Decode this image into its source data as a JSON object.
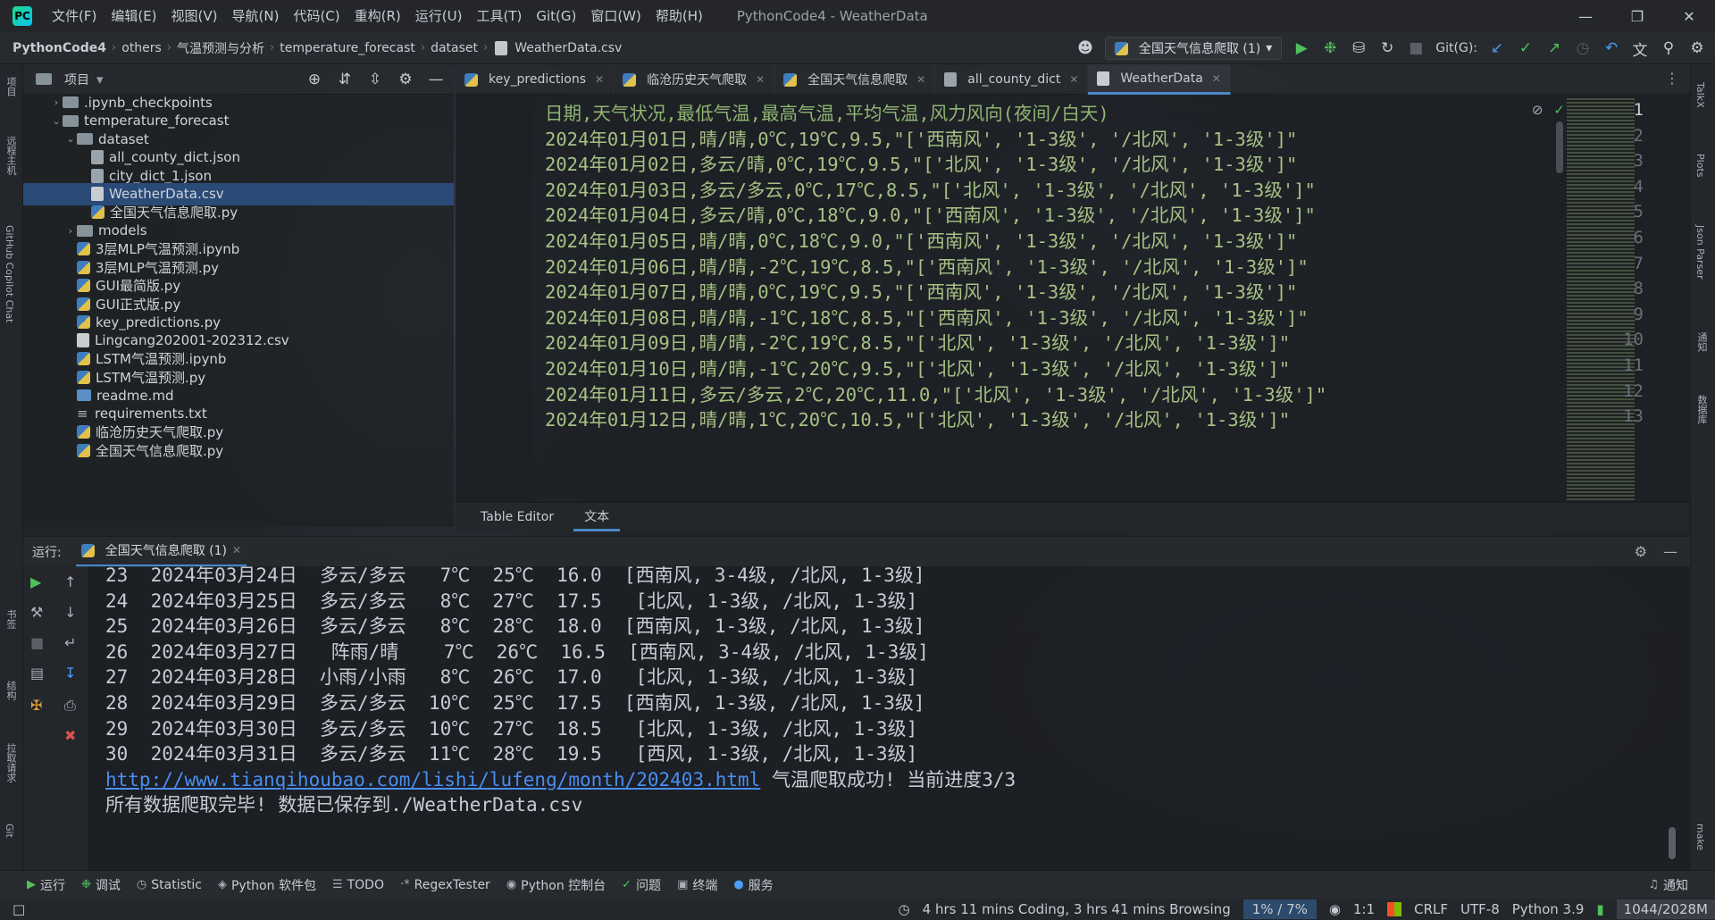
{
  "menubar": {
    "items": [
      "文件(F)",
      "编辑(E)",
      "视图(V)",
      "导航(N)",
      "代码(C)",
      "重构(R)",
      "运行(U)",
      "工具(T)",
      "Git(G)",
      "窗口(W)",
      "帮助(H)"
    ],
    "window_title": "PythonCode4 - WeatherData"
  },
  "breadcrumb": [
    "PythonCode4",
    "others",
    "气温预测与分析",
    "temperature_forecast",
    "dataset",
    "WeatherData.csv"
  ],
  "toolbar": {
    "run_config": "全国天气信息爬取 (1)",
    "git_label": "Git(G):"
  },
  "left_stripe": {
    "items": [
      "项目",
      "远程主机",
      "GitHub Copilot Chat",
      "书签",
      "结构",
      "拉取请求",
      "Git"
    ]
  },
  "right_stripe": {
    "items": [
      "TalkX",
      "Plots",
      "Json Parser",
      "通知",
      "数据库",
      "make"
    ]
  },
  "project": {
    "title": "项目",
    "tree": [
      {
        "label": ".ipynb_checkpoints",
        "type": "folder",
        "depth": 1,
        "arrow": "›"
      },
      {
        "label": "temperature_forecast",
        "type": "folder",
        "depth": 1,
        "arrow": "⌄"
      },
      {
        "label": "dataset",
        "type": "folder",
        "depth": 2,
        "arrow": "⌄"
      },
      {
        "label": "all_county_dict.json",
        "type": "json",
        "depth": 3,
        "arrow": ""
      },
      {
        "label": "city_dict_1.json",
        "type": "json",
        "depth": 3,
        "arrow": ""
      },
      {
        "label": "WeatherData.csv",
        "type": "csv",
        "depth": 3,
        "arrow": "",
        "selected": true
      },
      {
        "label": "全国天气信息爬取.py",
        "type": "py",
        "depth": 3,
        "arrow": ""
      },
      {
        "label": "models",
        "type": "folder",
        "depth": 2,
        "arrow": "›"
      },
      {
        "label": "3层MLP气温预测.ipynb",
        "type": "py",
        "depth": 2,
        "arrow": ""
      },
      {
        "label": "3层MLP气温预测.py",
        "type": "py",
        "depth": 2,
        "arrow": ""
      },
      {
        "label": "GUI最简版.py",
        "type": "py",
        "depth": 2,
        "arrow": ""
      },
      {
        "label": "GUI正式版.py",
        "type": "py",
        "depth": 2,
        "arrow": ""
      },
      {
        "label": "key_predictions.py",
        "type": "py",
        "depth": 2,
        "arrow": ""
      },
      {
        "label": "Lingcang202001-202312.csv",
        "type": "csv",
        "depth": 2,
        "arrow": ""
      },
      {
        "label": "LSTM气温预测.ipynb",
        "type": "py",
        "depth": 2,
        "arrow": ""
      },
      {
        "label": "LSTM气温预测.py",
        "type": "py",
        "depth": 2,
        "arrow": ""
      },
      {
        "label": "readme.md",
        "type": "md",
        "depth": 2,
        "arrow": ""
      },
      {
        "label": "requirements.txt",
        "type": "txt",
        "depth": 2,
        "arrow": ""
      },
      {
        "label": "临沧历史天气爬取.py",
        "type": "py",
        "depth": 2,
        "arrow": ""
      },
      {
        "label": "全国天气信息爬取.py",
        "type": "py",
        "depth": 2,
        "arrow": ""
      }
    ]
  },
  "editor": {
    "tabs": [
      {
        "label": "key_predictions",
        "active": false
      },
      {
        "label": "临沧历史天气爬取",
        "active": false
      },
      {
        "label": "全国天气信息爬取",
        "active": false
      },
      {
        "label": "all_county_dict",
        "active": false
      },
      {
        "label": "WeatherData",
        "active": true
      }
    ],
    "lines": [
      "日期,天气状况,最低气温,最高气温,平均气温,风力风向(夜间/白天)",
      "2024年01月01日,晴/晴,0℃,19℃,9.5,\"['西南风', '1-3级', '/北风', '1-3级']\"",
      "2024年01月02日,多云/晴,0℃,19℃,9.5,\"['北风', '1-3级', '/北风', '1-3级']\"",
      "2024年01月03日,多云/多云,0℃,17℃,8.5,\"['北风', '1-3级', '/北风', '1-3级']\"",
      "2024年01月04日,多云/晴,0℃,18℃,9.0,\"['西南风', '1-3级', '/北风', '1-3级']\"",
      "2024年01月05日,晴/晴,0℃,18℃,9.0,\"['西南风', '1-3级', '/北风', '1-3级']\"",
      "2024年01月06日,晴/晴,-2℃,19℃,8.5,\"['西南风', '1-3级', '/北风', '1-3级']\"",
      "2024年01月07日,晴/晴,0℃,19℃,9.5,\"['西南风', '1-3级', '/北风', '1-3级']\"",
      "2024年01月08日,晴/晴,-1℃,18℃,8.5,\"['西南风', '1-3级', '/北风', '1-3级']\"",
      "2024年01月09日,晴/晴,-2℃,19℃,8.5,\"['北风', '1-3级', '/北风', '1-3级']\"",
      "2024年01月10日,晴/晴,-1℃,20℃,9.5,\"['北风', '1-3级', '/北风', '1-3级']\"",
      "2024年01月11日,多云/多云,2℃,20℃,11.0,\"['北风', '1-3级', '/北风', '1-3级']\"",
      "2024年01月12日,晴/晴,1℃,20℃,10.5,\"['北风', '1-3级', '/北风', '1-3级']\""
    ],
    "bottom_tabs": [
      {
        "label": "Table Editor",
        "active": false
      },
      {
        "label": "文本",
        "active": true
      }
    ]
  },
  "run_panel": {
    "label": "运行:",
    "tab": "全国天气信息爬取 (1)",
    "rows": [
      "23  2024年03月24日  多云/多云   7℃  25℃  16.0  [西南风, 3-4级, /北风, 1-3级]",
      "24  2024年03月25日  多云/多云   8℃  27℃  17.5   [北风, 1-3级, /北风, 1-3级]",
      "25  2024年03月26日  多云/多云   8℃  28℃  18.0  [西南风, 1-3级, /北风, 1-3级]",
      "26  2024年03月27日   阵雨/晴    7℃  26℃  16.5  [西南风, 3-4级, /北风, 1-3级]",
      "27  2024年03月28日  小雨/小雨   8℃  26℃  17.0   [北风, 1-3级, /北风, 1-3级]",
      "28  2024年03月29日  多云/多云  10℃  25℃  17.5  [西南风, 1-3级, /北风, 1-3级]",
      "29  2024年03月30日  多云/多云  10℃  27℃  18.5   [北风, 1-3级, /北风, 1-3级]",
      "30  2024年03月31日  多云/多云  11℃  28℃  19.5   [西风, 1-3级, /北风, 1-3级]"
    ],
    "link": "http://www.tianqihoubao.com/lishi/lufeng/month/202403.html",
    "link_suffix": " 气温爬取成功! 当前进度3/3",
    "final": "所有数据爬取完毕! 数据已保存到./WeatherData.csv"
  },
  "tool_windows": [
    {
      "label": "运行",
      "icon": "play-icon"
    },
    {
      "label": "调试",
      "icon": "bug-icon"
    },
    {
      "label": "Statistic",
      "icon": "clock-icon"
    },
    {
      "label": "Python 软件包",
      "icon": "package-icon"
    },
    {
      "label": "TODO",
      "icon": "list-icon"
    },
    {
      "label": "RegexTester",
      "icon": "regex-icon"
    },
    {
      "label": "Python 控制台",
      "icon": "python-icon"
    },
    {
      "label": "问题",
      "icon": "check-icon"
    },
    {
      "label": "终端",
      "icon": "terminal-icon"
    },
    {
      "label": "服务",
      "icon": "services-icon"
    }
  ],
  "notifications_label": "通知",
  "statusbar": {
    "coding_time": "4 hrs 11 mins Coding, 3 hrs 41 mins Browsing",
    "progress": "1% / 7%",
    "position": "1:1",
    "line_sep": "CRLF",
    "encoding": "UTF-8",
    "interpreter": "Python 3.9",
    "memory": "1044/2028M"
  },
  "colors": {
    "accent": "#4a88c7",
    "selection": "#2a4a78",
    "csv_text": "#a7c184",
    "link": "#4a8ef0",
    "run_green": "#4fc15a"
  }
}
